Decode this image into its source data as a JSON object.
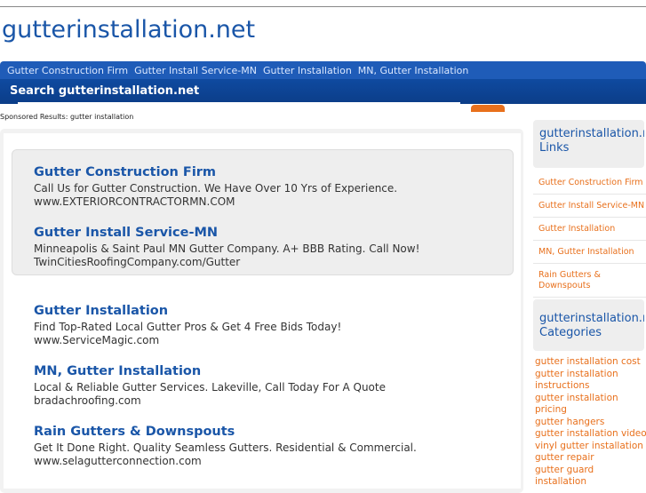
{
  "site": {
    "title": "gutterinstallation.net"
  },
  "nav": {
    "items": [
      {
        "label": "Gutter Construction Firm"
      },
      {
        "label": "Gutter Install Service-MN"
      },
      {
        "label": "Gutter Installation"
      },
      {
        "label": "MN, Gutter Installation"
      }
    ]
  },
  "search": {
    "label": "Search gutterinstallation.net",
    "value": "",
    "button_label": ""
  },
  "sponsored_label": "Sponsored Results: gutter installation",
  "ads": [
    {
      "title": "Gutter Construction Firm",
      "desc": "Call Us for Gutter Construction. We Have Over 10 Yrs of Experience.",
      "url": "www.EXTERIORCONTRACTORMN.COM"
    },
    {
      "title": "Gutter Install Service-MN",
      "desc": "Minneapolis & Saint Paul MN Gutter Company. A+ BBB Rating. Call Now!",
      "url": "TwinCitiesRoofingCompany.com/Gutter"
    },
    {
      "title": "Gutter Installation",
      "desc": "Find Top-Rated Local Gutter Pros & Get 4 Free Bids Today!",
      "url": "www.ServiceMagic.com"
    },
    {
      "title": "MN, Gutter Installation",
      "desc": "Local & Reliable Gutter Services. Lakeville, Call Today For A Quote",
      "url": "bradachroofing.com"
    },
    {
      "title": "Rain Gutters & Downspouts",
      "desc": "Get It Done Right. Quality Seamless Gutters. Residential & Commercial.",
      "url": "www.selagutterconnection.com"
    }
  ],
  "sidebar": {
    "links_title_1": "gutterinstallation.net",
    "links_title_2": "Links",
    "links": [
      {
        "label": "Gutter Construction Firm"
      },
      {
        "label": "Gutter Install Service-MN"
      },
      {
        "label": "Gutter Installation"
      },
      {
        "label": "MN, Gutter Installation"
      },
      {
        "label": "Rain Gutters &"
      },
      {
        "label": "Downspouts"
      }
    ],
    "categories_title_1": "gutterinstallation.net",
    "categories_title_2": "Categories",
    "categories": [
      "gutter installation cost",
      "gutter installation",
      "instructions",
      "gutter installation",
      "pricing",
      "gutter hangers",
      "gutter installation video",
      "vinyl gutter installation",
      "gutter repair",
      "gutter guard",
      "installation"
    ]
  },
  "colors": {
    "brand": "#1a56a8",
    "nav_bg": "#1f5cb8",
    "accent": "#e8701c"
  }
}
